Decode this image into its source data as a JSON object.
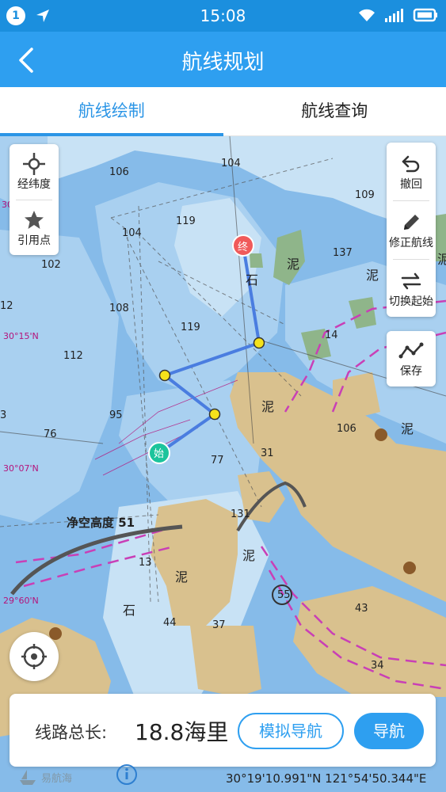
{
  "status_bar": {
    "notification_count": "1",
    "time": "15:08"
  },
  "header": {
    "title": "航线规划"
  },
  "tabs": [
    {
      "label": "航线绘制",
      "active": true
    },
    {
      "label": "航线查询",
      "active": false
    }
  ],
  "left_tools": [
    {
      "label": "经纬度",
      "icon": "crosshair-icon"
    },
    {
      "label": "引用点",
      "icon": "star-icon"
    }
  ],
  "right_tools": [
    {
      "label": "撤回",
      "icon": "undo-icon"
    },
    {
      "label": "修正航线",
      "icon": "pencil-icon"
    },
    {
      "label": "切换起始",
      "icon": "swap-icon"
    }
  ],
  "save_tool": {
    "label": "保存",
    "icon": "route-icon"
  },
  "markers": {
    "start": "始",
    "end": "终"
  },
  "map": {
    "depths": [
      "106",
      "104",
      "109",
      "119",
      "104",
      "137",
      "102",
      "108",
      "119",
      "14",
      "112",
      "95",
      "106",
      "76",
      "77",
      "31",
      "131",
      "13",
      "44",
      "37",
      "55",
      "43",
      "34",
      "12",
      "3",
      "30"
    ],
    "labels": [
      "泥",
      "石",
      "泥",
      "泥",
      "泥",
      "泥",
      "泥",
      "石",
      "泥"
    ],
    "bridge_label": "净空高度 51",
    "lat_labels": [
      "30°15'N",
      "30°07'N",
      "29°60'N"
    ],
    "colors": {
      "deep_water": "#7fb6e6",
      "shallow_water": "#a9d0f0",
      "very_shallow": "#c8e2f5",
      "land": "#d9c18e",
      "route": "#4a7de0",
      "waypoint": "#f5e21b",
      "lane": "#c93fb6"
    }
  },
  "route_card": {
    "label": "线路总长:",
    "value": "18.8海里",
    "simulate_button": "模拟导航",
    "navigate_button": "导航"
  },
  "coordinates": "30°19'10.991\"N 121°54'50.344\"E",
  "brand": "易航海"
}
